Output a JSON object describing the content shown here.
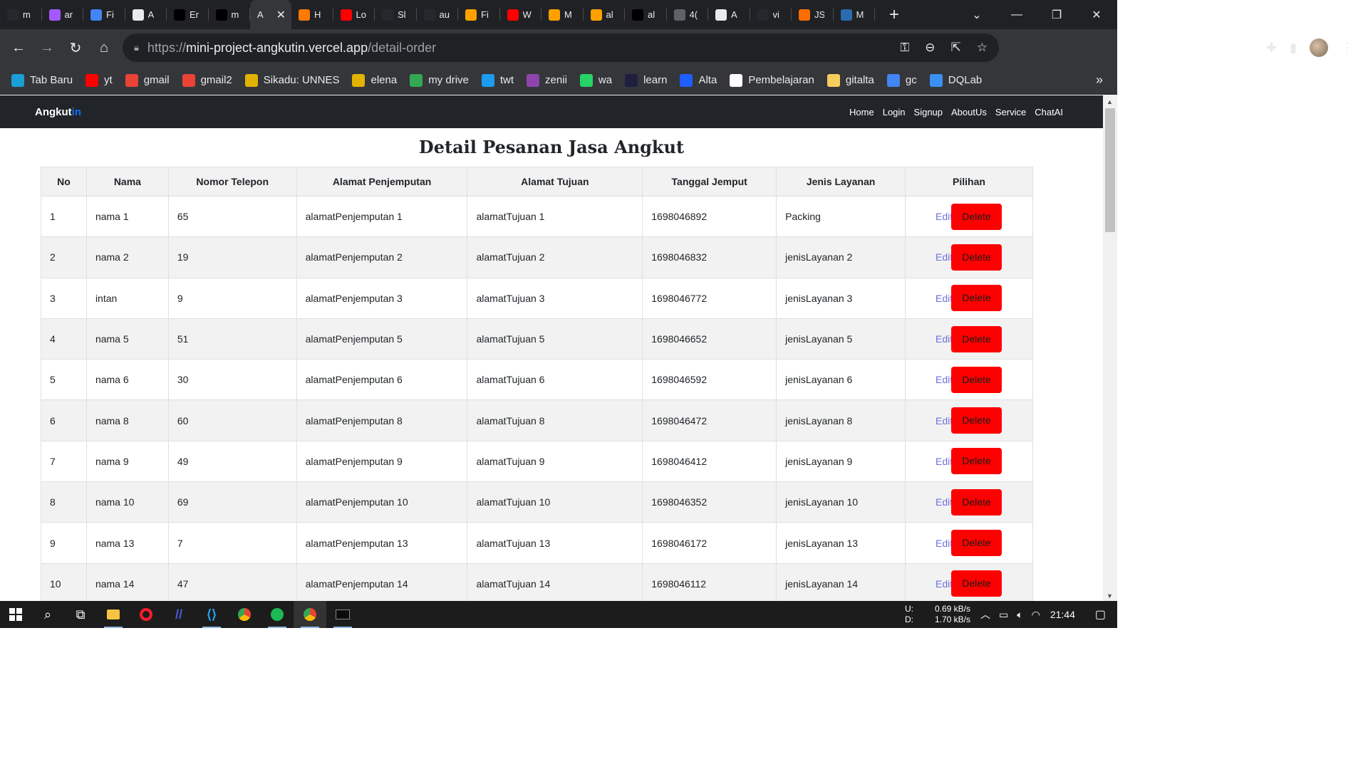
{
  "browser": {
    "tabs": [
      {
        "text": "m",
        "icon": "github-icon",
        "color": "#24292e"
      },
      {
        "text": "ar",
        "icon": "figma-icon",
        "color": "#a259ff"
      },
      {
        "text": "Fi",
        "icon": "docs-icon",
        "color": "#4285f4"
      },
      {
        "text": "A",
        "icon": "site-icon",
        "color": "#e8eaed"
      },
      {
        "text": "Er",
        "icon": "triangle-icon",
        "color": "#000000"
      },
      {
        "text": "m",
        "icon": "triangle-icon",
        "color": "#000000"
      },
      {
        "text": "A",
        "icon": "",
        "color": "",
        "active": true
      },
      {
        "text": "H",
        "icon": "orange-u-icon",
        "color": "#ff7a00"
      },
      {
        "text": "Lo",
        "icon": "youtube-icon",
        "color": "#ff0000"
      },
      {
        "text": "Sl",
        "icon": "github-icon",
        "color": "#24292e"
      },
      {
        "text": "au",
        "icon": "github-icon",
        "color": "#24292e"
      },
      {
        "text": "Fi",
        "icon": "firebase-icon",
        "color": "#ffa000"
      },
      {
        "text": "W",
        "icon": "youtube-icon",
        "color": "#ff0000"
      },
      {
        "text": "M",
        "icon": "firebase-icon",
        "color": "#ffa000"
      },
      {
        "text": "al",
        "icon": "firebase-icon",
        "color": "#ffa000"
      },
      {
        "text": "al",
        "icon": "triangle-icon",
        "color": "#000000"
      },
      {
        "text": "4(",
        "icon": "globe-icon",
        "color": "#5f6368"
      },
      {
        "text": "A",
        "icon": "site-icon",
        "color": "#e8eaed"
      },
      {
        "text": "vi",
        "icon": "github-icon",
        "color": "#24292e"
      },
      {
        "text": "JS",
        "icon": "orange-js-icon",
        "color": "#ff6d00"
      },
      {
        "text": "M",
        "icon": "mt-icon",
        "color": "#2b6cb0"
      }
    ],
    "url_prefix": "https://",
    "url_host": "mini-project-angkutin.vercel.app",
    "url_path": "/detail-order",
    "bookmarks": [
      {
        "label": "Tab Baru",
        "icon": "new-tab-icon",
        "color": "#1a9fd6"
      },
      {
        "label": "yt",
        "icon": "youtube-icon",
        "color": "#ff0000"
      },
      {
        "label": "gmail",
        "icon": "gmail-icon",
        "color": "#ea4335"
      },
      {
        "label": "gmail2",
        "icon": "gmail-icon",
        "color": "#ea4335"
      },
      {
        "label": "Sikadu: UNNES",
        "icon": "unnes-icon",
        "color": "#e1b300"
      },
      {
        "label": "elena",
        "icon": "unnes-icon",
        "color": "#e1b300"
      },
      {
        "label": "my drive",
        "icon": "drive-icon",
        "color": "#34a853"
      },
      {
        "label": "twt",
        "icon": "twitter-icon",
        "color": "#1d9bf0"
      },
      {
        "label": "zenii",
        "icon": "zenius-icon",
        "color": "#8e44ad"
      },
      {
        "label": "wa",
        "icon": "whatsapp-icon",
        "color": "#25d366"
      },
      {
        "label": "learn",
        "icon": "learn-icon",
        "color": "#1e1e3f"
      },
      {
        "label": "Alta",
        "icon": "alta-icon",
        "color": "#1f5eff"
      },
      {
        "label": "Pembelajaran",
        "icon": "notion-icon",
        "color": "#ffffff"
      },
      {
        "label": "gitalta",
        "icon": "folder-icon",
        "color": "#f6cc5c"
      },
      {
        "label": "gc",
        "icon": "calendar-icon",
        "color": "#4285f4"
      },
      {
        "label": "DQLab",
        "icon": "dqlab-icon",
        "color": "#3b8ff2"
      }
    ]
  },
  "app": {
    "brand_main": "Angkut",
    "brand_accent": "in",
    "nav": [
      "Home",
      "Login",
      "Signup",
      "AboutUs",
      "Service",
      "ChatAI"
    ],
    "title": "Detail Pesanan Jasa Angkut",
    "columns": [
      "No",
      "Nama",
      "Nomor Telepon",
      "Alamat Penjemputan",
      "Alamat Tujuan",
      "Tanggal Jemput",
      "Jenis Layanan",
      "Pilihan"
    ],
    "edit_label": "Edit",
    "delete_label": "Delete",
    "rows": [
      [
        "1",
        "nama 1",
        "65",
        "alamatPenjemputan 1",
        "alamatTujuan 1",
        "1698046892",
        "Packing"
      ],
      [
        "2",
        "nama 2",
        "19",
        "alamatPenjemputan 2",
        "alamatTujuan 2",
        "1698046832",
        "jenisLayanan 2"
      ],
      [
        "3",
        "intan",
        "9",
        "alamatPenjemputan 3",
        "alamatTujuan 3",
        "1698046772",
        "jenisLayanan 3"
      ],
      [
        "4",
        "nama 5",
        "51",
        "alamatPenjemputan 5",
        "alamatTujuan 5",
        "1698046652",
        "jenisLayanan 5"
      ],
      [
        "5",
        "nama 6",
        "30",
        "alamatPenjemputan 6",
        "alamatTujuan 6",
        "1698046592",
        "jenisLayanan 6"
      ],
      [
        "6",
        "nama 8",
        "60",
        "alamatPenjemputan 8",
        "alamatTujuan 8",
        "1698046472",
        "jenisLayanan 8"
      ],
      [
        "7",
        "nama 9",
        "49",
        "alamatPenjemputan 9",
        "alamatTujuan 9",
        "1698046412",
        "jenisLayanan 9"
      ],
      [
        "8",
        "nama 10",
        "69",
        "alamatPenjemputan 10",
        "alamatTujuan 10",
        "1698046352",
        "jenisLayanan 10"
      ],
      [
        "9",
        "nama 13",
        "7",
        "alamatPenjemputan 13",
        "alamatTujuan 13",
        "1698046172",
        "jenisLayanan 13"
      ],
      [
        "10",
        "nama 14",
        "47",
        "alamatPenjemputan 14",
        "alamatTujuan 14",
        "1698046112",
        "jenisLayanan 14"
      ]
    ]
  },
  "taskbar": {
    "net_up_label": "U:",
    "net_down_label": "D:",
    "net_up": "0.69 kB/s",
    "net_down": "1.70 kB/s",
    "time": "21:44"
  }
}
